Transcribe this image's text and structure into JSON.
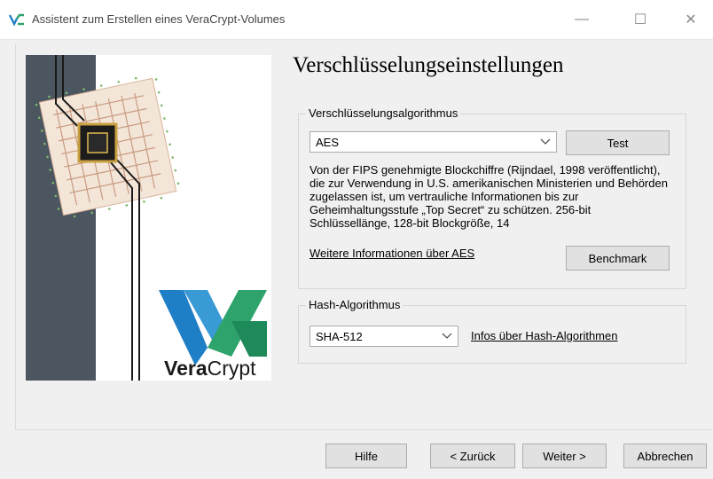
{
  "window": {
    "title": "Assistent zum Erstellen eines VeraCrypt-Volumes",
    "minimize_glyph": "—",
    "maximize_glyph": "☐",
    "close_glyph": "✕"
  },
  "banner": {
    "logo_text_bold": "Vera",
    "logo_text_light": "Crypt"
  },
  "page": {
    "heading": "Verschlüsselungseinstellungen"
  },
  "encryption": {
    "group_title": "Verschlüsselungsalgorithmus",
    "selected": "AES",
    "test_label": "Test",
    "description": "Von der FIPS genehmigte Blockchiffre (Rijndael, 1998 veröffentlicht), die zur Verwendung in U.S. amerikanischen Ministerien und Behörden zugelassen ist, um vertrauliche Informationen bis zur Geheimhaltungsstufe „Top Secret“ zu schützen. 256-bit Schlüssellänge, 128-bit Blockgröße, 14",
    "more_info_link": "Weitere Informationen über AES",
    "benchmark_label": "Benchmark"
  },
  "hash": {
    "group_title": "Hash-Algorithmus",
    "selected": "SHA-512",
    "info_link": "Infos über Hash-Algorithmen"
  },
  "footer": {
    "help": "Hilfe",
    "back": "< Zurück",
    "next": "Weiter >",
    "cancel": "Abbrechen"
  },
  "colors": {
    "accent_blue": "#1f7fc6",
    "accent_green": "#2ea36b",
    "banner_dark": "#4b5660"
  }
}
